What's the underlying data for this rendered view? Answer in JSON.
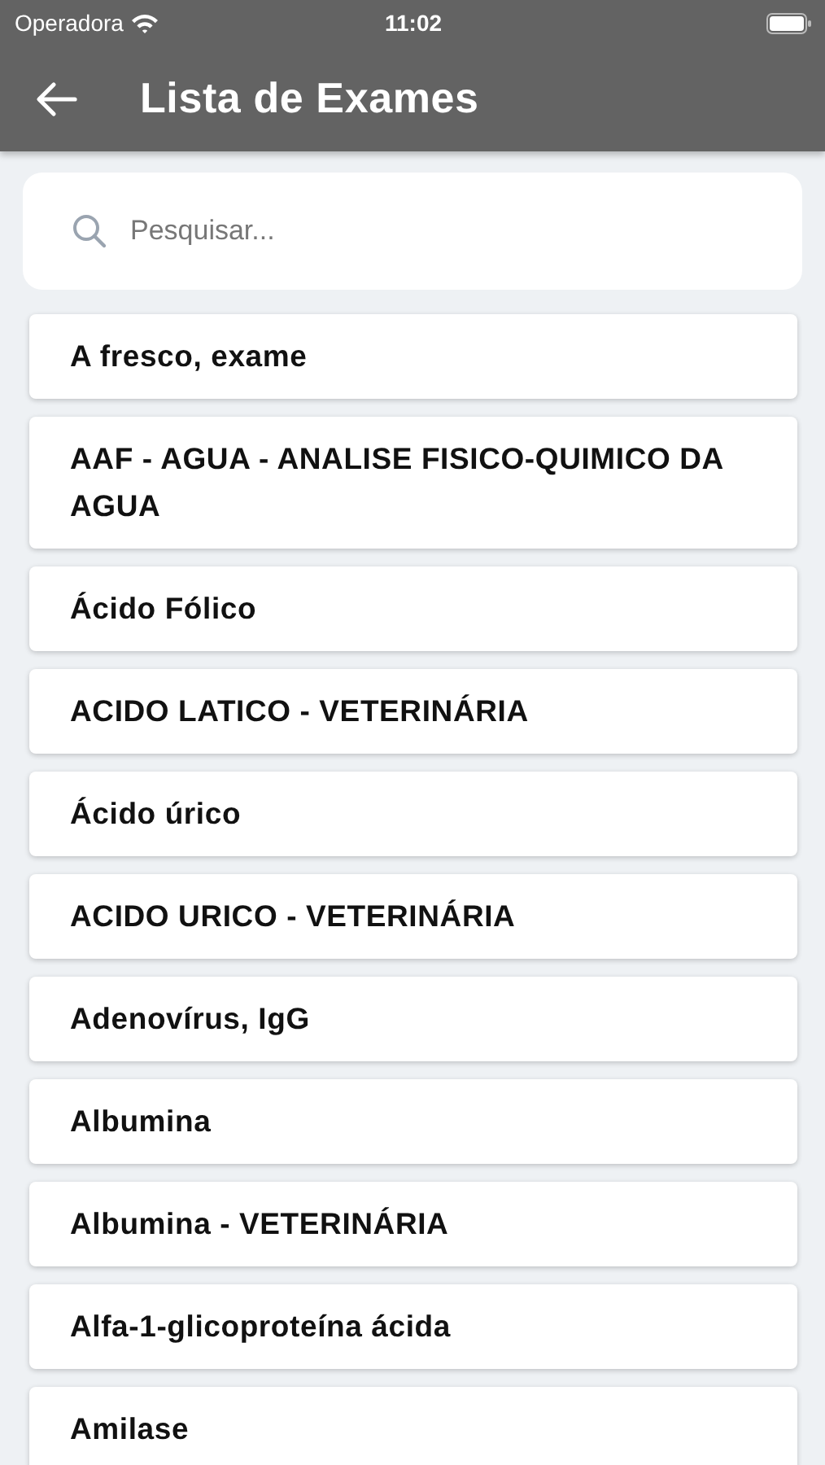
{
  "status_bar": {
    "carrier": "Operadora",
    "time": "11:02"
  },
  "app_bar": {
    "title": "Lista de Exames"
  },
  "search": {
    "placeholder": "Pesquisar..."
  },
  "exams": [
    "A fresco, exame",
    "AAF - AGUA - ANALISE FISICO-QUIMICO DA AGUA",
    "Ácido Fólico",
    "ACIDO LATICO - VETERINÁRIA",
    "Ácido úrico",
    "ACIDO URICO - VETERINÁRIA",
    "Adenovírus, IgG",
    "Albumina",
    "Albumina - VETERINÁRIA",
    "Alfa-1-glicoproteína ácida",
    "Amilase"
  ]
}
